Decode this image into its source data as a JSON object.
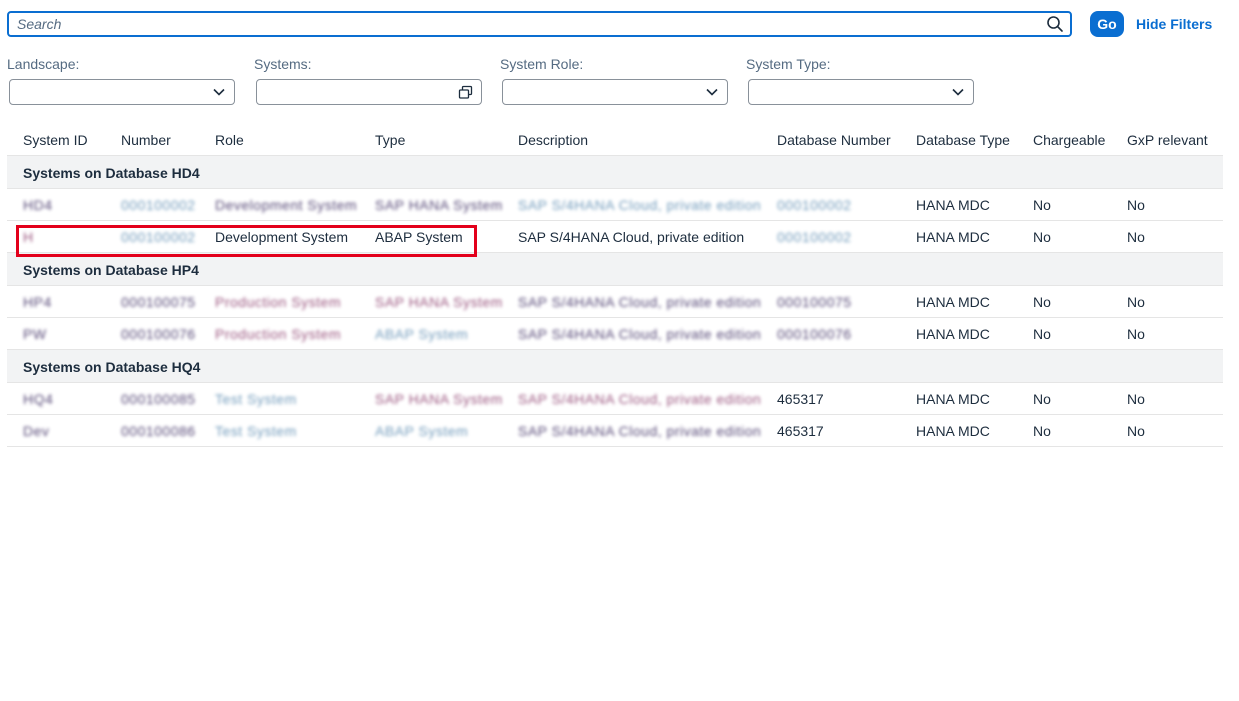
{
  "search": {
    "placeholder": "Search",
    "value": ""
  },
  "go_label": "Go",
  "hide_filters_label": "Hide Filters",
  "filters": [
    {
      "label": "Landscape:",
      "value": "",
      "control": "dropdown"
    },
    {
      "label": "Systems:",
      "value": "",
      "control": "value-help"
    },
    {
      "label": "System Role:",
      "value": "",
      "control": "dropdown"
    },
    {
      "label": "System Type:",
      "value": "",
      "control": "dropdown"
    }
  ],
  "table": {
    "columns": [
      "System ID",
      "Number",
      "Role",
      "Type",
      "Description",
      "Database Number",
      "Database Type",
      "Chargeable",
      "GxP relevant"
    ],
    "groups": [
      {
        "label": "Systems on Database HD4",
        "rows": [
          {
            "system_id": "HD4",
            "number": "000100002",
            "role": "Development System",
            "type": "SAP HANA System",
            "description": "SAP S/4HANA Cloud, private edition",
            "db_number": "000100002",
            "db_type": "HANA MDC",
            "chargeable": "No",
            "gxp": "No",
            "obscured": true
          },
          {
            "system_id": "H",
            "number": "000100002",
            "role": "Development System",
            "type": "ABAP System",
            "description": "SAP S/4HANA Cloud, private edition",
            "db_number": "000100002",
            "db_type": "HANA MDC",
            "chargeable": "No",
            "gxp": "No",
            "obscured_cols": [
              "system_id",
              "number",
              "db_number"
            ]
          }
        ]
      },
      {
        "label": "Systems on Database HP4",
        "rows": [
          {
            "system_id": "HP4",
            "number": "000100075",
            "role": "Production System",
            "type": "SAP HANA System",
            "description": "SAP S/4HANA Cloud, private edition",
            "db_number": "000100075",
            "db_type": "HANA MDC",
            "chargeable": "No",
            "gxp": "No",
            "obscured": true
          },
          {
            "system_id": "PW",
            "number": "000100076",
            "role": "Production System",
            "type": "ABAP System",
            "description": "SAP S/4HANA Cloud, private edition",
            "db_number": "000100076",
            "db_type": "HANA MDC",
            "chargeable": "No",
            "gxp": "No",
            "obscured": true
          }
        ]
      },
      {
        "label": "Systems on Database HQ4",
        "rows": [
          {
            "system_id": "HQ4",
            "number": "000100085",
            "role": "Test System",
            "type": "SAP HANA System",
            "description": "SAP S/4HANA Cloud, private edition",
            "db_number": "465317",
            "db_type": "HANA MDC",
            "chargeable": "No",
            "gxp": "No",
            "obscured": true
          },
          {
            "system_id": "Dev",
            "number": "000100086",
            "role": "Test System",
            "type": "ABAP System",
            "description": "SAP S/4HANA Cloud, private edition",
            "db_number": "465317",
            "db_type": "HANA MDC",
            "chargeable": "No",
            "gxp": "No",
            "obscured": true
          }
        ]
      }
    ]
  },
  "colors": {
    "accent": "#0a6ed1",
    "highlight_border": "#e3001b",
    "group_bg": "#f2f3f4"
  }
}
